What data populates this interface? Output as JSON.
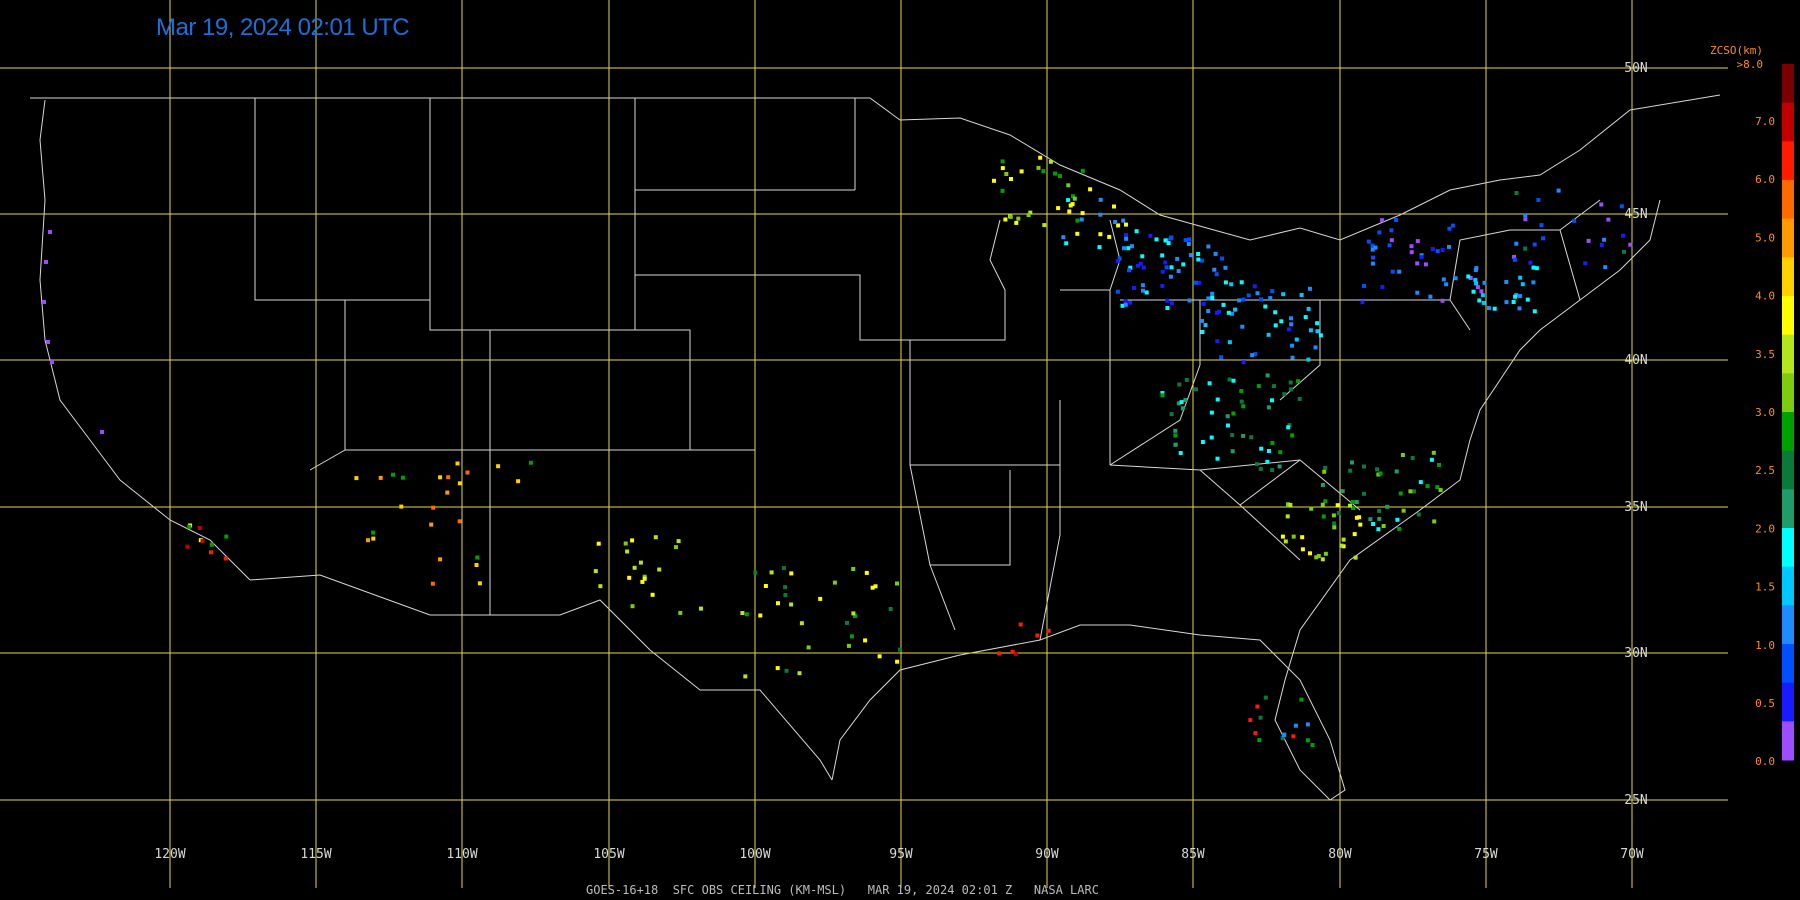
{
  "timestamp": "Mar 19, 2024 02:01 UTC",
  "footer": "GOES-16+18  SFC OBS CEILING (KM-MSL)   MAR 19, 2024 02:01 Z   NASA LARC",
  "longitude_labels": [
    "120W",
    "115W",
    "110W",
    "105W",
    "100W",
    "95W",
    "90W",
    "85W",
    "80W",
    "75W",
    "70W"
  ],
  "latitude_labels": [
    "50N",
    "45N",
    "40N",
    "35N",
    "30N",
    "25N"
  ],
  "legend": {
    "title": "ZCSO(km)",
    "top_label": ">8.0",
    "ticks": [
      "7.0",
      "6.0",
      "5.0",
      "4.0",
      "3.5",
      "3.0",
      "2.5",
      "2.0",
      "1.5",
      "1.0",
      "0.5",
      "0.0"
    ],
    "colors": [
      "#7a0000",
      "#c00000",
      "#ff1a00",
      "#ff6a00",
      "#ff9a00",
      "#ffd000",
      "#ffff00",
      "#b5e61d",
      "#7ccc10",
      "#00a000",
      "#0a7a3a",
      "#1f9c6a",
      "#00ffff",
      "#00c8ff",
      "#1e8cff",
      "#0050ff",
      "#1a1aff",
      "#9b4dff"
    ],
    "label_color": "#ff8c1a"
  },
  "colors": {
    "grid": "#e6d84a",
    "borders": "#dcdcdc",
    "background": "#000000",
    "timestamp": "#1b6fd8"
  }
}
